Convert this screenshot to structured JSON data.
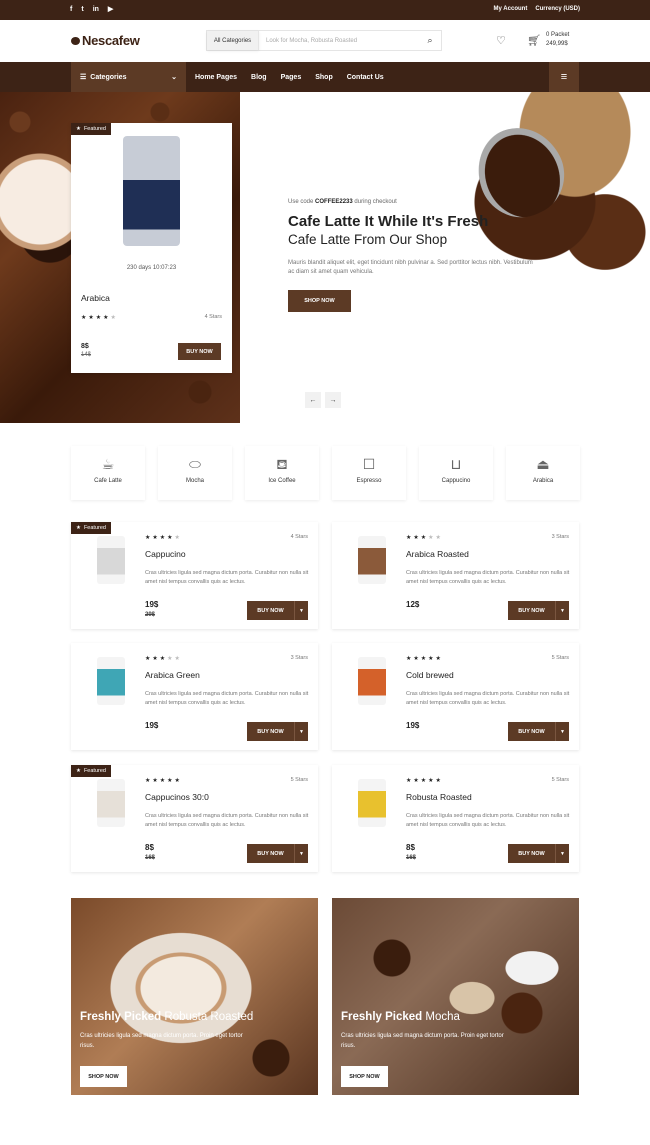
{
  "topbar": {
    "social": [
      "f",
      "t",
      "in",
      "▶"
    ],
    "my_account": "My Account",
    "currency": "Currency (USD)"
  },
  "header": {
    "logo": "Nescafew",
    "search_category": "All Categories",
    "search_placeholder": "Look for Mocha, Robusta Roasted",
    "cart_count": "0 Packet",
    "cart_total": "249,99$"
  },
  "nav": {
    "categories_label": "Categories",
    "links": [
      "Home Pages",
      "Blog",
      "Pages",
      "Shop",
      "Contact Us"
    ]
  },
  "hero": {
    "featured_tag": "Featured",
    "card_countdown": "230 days 10:07:23",
    "card_name": "Arabica",
    "card_stars_label": "4 Stars",
    "card_price": "8$",
    "card_old_price": "14$",
    "card_buy": "BUY NOW",
    "promo_prefix": "Use code",
    "promo_code": "COFFEE2233",
    "promo_suffix": "during checkout",
    "title": "Cafe Latte It While It's Fresh",
    "subtitle": "Cafe Latte From Our Shop",
    "description": "Mauris blandit aliquet elit, eget tincidunt nibh pulvinar a. Sed porttitor lectus nibh. Vestibulum ac diam sit amet quam vehicula.",
    "button": "SHOP NOW",
    "prev": "←",
    "next": "→"
  },
  "categories": [
    {
      "label": "Cafe Latte",
      "icon": "coffee-cup-icon"
    },
    {
      "label": "Mocha",
      "icon": "coffee-bean-icon"
    },
    {
      "label": "Ice Coffee",
      "icon": "coffee-machine-icon"
    },
    {
      "label": "Espresso",
      "icon": "paper-cup-icon"
    },
    {
      "label": "Cappucino",
      "icon": "iced-cup-icon"
    },
    {
      "label": "Arabica",
      "icon": "moka-pot-icon"
    }
  ],
  "products": [
    {
      "name": "Cappucino",
      "stars": 4,
      "stars_label": "4 Stars",
      "desc": "Cras ultricies ligula sed magna dictum porta. Curabitur non nulla sit amet nisl tempus convallis quis ac lectus.",
      "price": "19$",
      "old_price": "29$",
      "buy": "BUY NOW",
      "featured": "Featured",
      "color": "#d8d8d8"
    },
    {
      "name": "Arabica Roasted",
      "stars": 3,
      "stars_label": "3 Stars",
      "desc": "Cras ultricies ligula sed magna dictum porta. Curabitur non nulla sit amet nisl tempus convallis quis ac lectus.",
      "price": "12$",
      "old_price": "",
      "buy": "BUY NOW",
      "featured": "",
      "color": "#8b5a3a"
    },
    {
      "name": "Arabica Green",
      "stars": 3,
      "stars_label": "3 Stars",
      "desc": "Cras ultricies ligula sed magna dictum porta. Curabitur non nulla sit amet nisl tempus convallis quis ac lectus.",
      "price": "19$",
      "old_price": "",
      "buy": "BUY NOW",
      "featured": "",
      "color": "#3fa6b5"
    },
    {
      "name": "Cold brewed",
      "stars": 5,
      "stars_label": "5 Stars",
      "desc": "Cras ultricies ligula sed magna dictum porta. Curabitur non nulla sit amet nisl tempus convallis quis ac lectus.",
      "price": "19$",
      "old_price": "",
      "buy": "BUY NOW",
      "featured": "",
      "color": "#d4612a"
    },
    {
      "name": "Cappucinos 30:0",
      "stars": 5,
      "stars_label": "5 Stars",
      "desc": "Cras ultricies ligula sed magna dictum porta. Curabitur non nulla sit amet nisl tempus convallis quis ac lectus.",
      "price": "8$",
      "old_price": "16$",
      "buy": "BUY NOW",
      "featured": "Featured",
      "color": "#e6e0d8"
    },
    {
      "name": "Robusta Roasted",
      "stars": 5,
      "stars_label": "5 Stars",
      "desc": "Cras ultricies ligula sed magna dictum porta. Curabitur non nulla sit amet nisl tempus convallis quis ac lectus.",
      "price": "8$",
      "old_price": "16$",
      "buy": "BUY NOW",
      "featured": "",
      "color": "#e8c12e"
    }
  ],
  "banners": [
    {
      "bold": "Freshly Picked",
      "rest": "Robusta Roasted",
      "desc": "Cras ultricies ligula sed magna dictum porta. Proin eget tortor risus.",
      "button": "SHOP NOW"
    },
    {
      "bold": "Freshly Picked",
      "rest": "Mocha",
      "desc": "Cras ultricies ligula sed magna dictum porta. Proin eget tortor risus.",
      "button": "SHOP NOW"
    }
  ],
  "colors": {
    "brand_dark": "#3d2316",
    "brand_mid": "#5c3a25"
  }
}
